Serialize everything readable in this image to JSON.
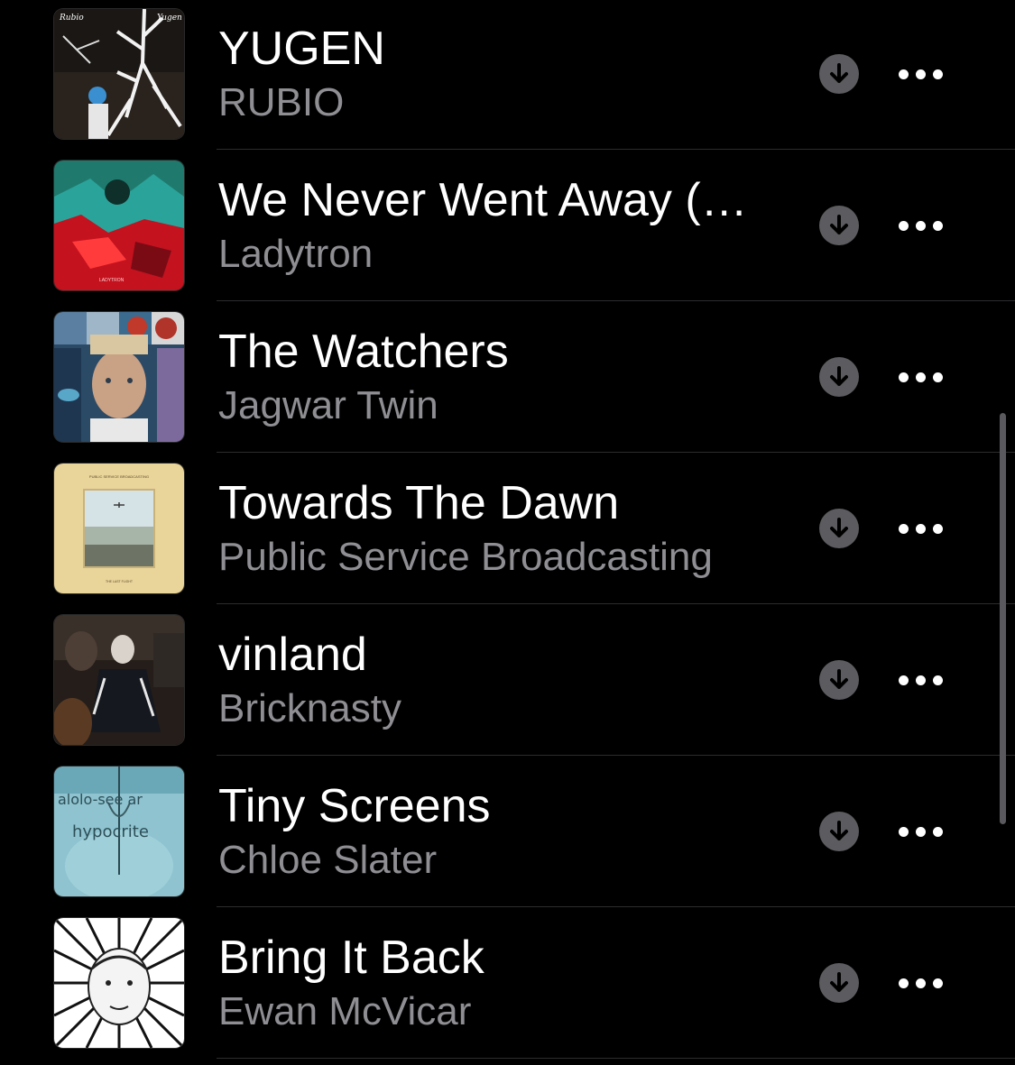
{
  "songs": [
    {
      "title": "YUGEN",
      "artist": "RUBIO",
      "artwork_icon": "album-art-yugen",
      "artwork_text_left": "Rubio",
      "artwork_text_right": "Yugen"
    },
    {
      "title": "We Never Went Away (…",
      "artist": "Ladytron",
      "artwork_icon": "album-art-ladytron",
      "artwork_text": "LADYTRON"
    },
    {
      "title": "The Watchers",
      "artist": "Jagwar Twin",
      "artwork_icon": "album-art-jagwar-twin"
    },
    {
      "title": "Towards The Dawn",
      "artist": "Public Service Broadcasting",
      "artwork_icon": "album-art-public-service-broadcasting",
      "artwork_text_top": "PUBLIC SERVICE BROADCASTING",
      "artwork_text_bottom": "THE LAST FLIGHT"
    },
    {
      "title": "vinland",
      "artist": "Bricknasty",
      "artwork_icon": "album-art-bricknasty"
    },
    {
      "title": "Tiny Screens",
      "artist": "Chloe Slater",
      "artwork_icon": "album-art-chloe-slater",
      "artwork_text_top": "alolo-see ar",
      "artwork_text": "hypocrite"
    },
    {
      "title": "Bring It Back",
      "artist": "Ewan McVicar",
      "artwork_icon": "album-art-ewan-mcvicar"
    }
  ],
  "actions": {
    "download_icon": "download-arrow-icon",
    "more_icon": "ellipsis-icon"
  },
  "colors": {
    "background": "#000000",
    "title": "#ffffff",
    "subtitle": "#8e8e93",
    "download_circle": "#5c5c60",
    "separator": "#2c2c2e"
  }
}
